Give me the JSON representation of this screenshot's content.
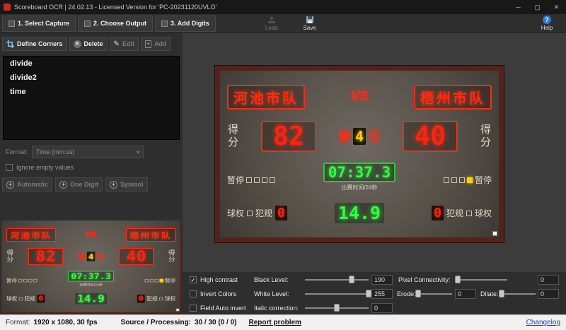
{
  "titlebar": {
    "title": "Scoreboard OCR | 24.02.13 - Licensed Version for 'PC-20231120UVLO'",
    "minimize": "─",
    "maximize": "▢",
    "close": "✕"
  },
  "toolbar": {
    "select_capture": "1. Select Capture",
    "choose_output": "2. Choose Output",
    "add_digits": "3. Add Digits",
    "load": "Load",
    "save": "Save",
    "help": "Help",
    "help_glyph": "?"
  },
  "corners": {
    "define": "Define Corners",
    "delete": "Delete",
    "edit": "Edit",
    "add": "Add",
    "delete_glyph": "✕",
    "edit_glyph": "✎",
    "add_glyph": "+"
  },
  "regions": {
    "items": [
      {
        "label": "divide"
      },
      {
        "label": "divide2"
      },
      {
        "label": "time"
      }
    ]
  },
  "format": {
    "label": "Format:",
    "value": "Time (mm:ss)",
    "arrow": "▾",
    "ignore_empty": "Ignore empty values"
  },
  "add_buttons": {
    "plus": "+",
    "automatic": "Automatic",
    "one_digit": "One Digit",
    "symbol": "Symbol"
  },
  "scoreboard": {
    "home_team": "河池市队",
    "vs": "VS",
    "away_team": "梧州市队",
    "score_label_left": "得分",
    "score_label_right": "得分",
    "home_score": "82",
    "away_score": "40",
    "period_prefix": "第",
    "period_digit": "4",
    "period_suffix": "节",
    "game_time": "07:37.3",
    "time_caption": "比赛时间/24秒",
    "pause_left": "暂停",
    "pause_right": "暂停",
    "possession_left": "球权",
    "possession_right": "球权",
    "fouls_left": "犯规",
    "fouls_right": "犯规",
    "fouls_left_value": "0",
    "fouls_right_value": "0",
    "shot_clock": "14.9"
  },
  "controls": {
    "check": "✓",
    "high_contrast": "High contrast",
    "black_level": "Black Level:",
    "black_level_value": "190",
    "invert_colors": "Invert Colors",
    "white_level": "White Level:",
    "white_level_value": "255",
    "field_auto_invert": "Field Auto invert",
    "italic_correction": "Italic correction:",
    "italic_correction_value": "0",
    "pixel_connectivity": "Pixel Connectivity:",
    "pixel_connectivity_value": "0",
    "erode": "Erode:",
    "erode_value": "0",
    "dilate": "Dilate:",
    "dilate_value": "0"
  },
  "sliders": {
    "black_level_pct": 73,
    "white_level_pct": 100,
    "italic_pct": 50,
    "pixel_pct": 0,
    "erode_pct": 0,
    "dilate_pct": 0
  },
  "statusbar": {
    "format_label": "Format:",
    "format_value": "1920 x 1080, 30 fps",
    "source_label": "Source / Processing:",
    "source_value": "30 / 30 (0 / 0)",
    "report": "Report problem",
    "changelog": "Changelog"
  },
  "colors": {
    "led_red": "#ff2b12",
    "led_green": "#31ff42",
    "led_yellow": "#ffd000",
    "accent_blue": "#2d7dd2",
    "frame_maroon": "#53221a"
  }
}
